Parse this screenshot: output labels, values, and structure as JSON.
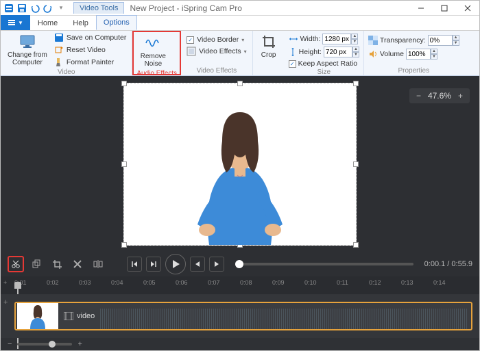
{
  "titlebar": {
    "video_tools_tag": "Video Tools",
    "title": "New Project - iSpring Cam Pro"
  },
  "tabs": {
    "file_glyph": "▼",
    "home": "Home",
    "help": "Help",
    "options": "Options"
  },
  "ribbon": {
    "video": {
      "change_from_computer": "Change from\nComputer",
      "save_on_computer": "Save on Computer",
      "reset_video": "Reset Video",
      "format_painter": "Format Painter",
      "group": "Video"
    },
    "audio": {
      "remove_noise": "Remove\nNoise",
      "group": "Audio Effects"
    },
    "veffects": {
      "video_border": "Video Border",
      "video_effects": "Video Effects",
      "group": "Video Effects"
    },
    "crop": {
      "label": "Crop"
    },
    "size": {
      "width_label": "Width:",
      "width_value": "1280 px",
      "height_label": "Height:",
      "height_value": "720 px",
      "keep_ar": "Keep Aspect Ratio",
      "group": "Size"
    },
    "props": {
      "transparency_label": "Transparency:",
      "transparency_value": "0%",
      "volume_label": "Volume",
      "volume_value": "100%",
      "group": "Properties"
    }
  },
  "zoom": {
    "value": "47.6%"
  },
  "transport": {
    "time": "0:00.1 / 0:55.9"
  },
  "ruler": {
    "ticks": [
      "0:01",
      "0:02",
      "0:03",
      "0:04",
      "0:05",
      "0:06",
      "0:07",
      "0:08",
      "0:09",
      "0:10",
      "0:11",
      "0:12",
      "0:13",
      "0:14"
    ]
  },
  "timeline": {
    "clip_label": "video"
  }
}
